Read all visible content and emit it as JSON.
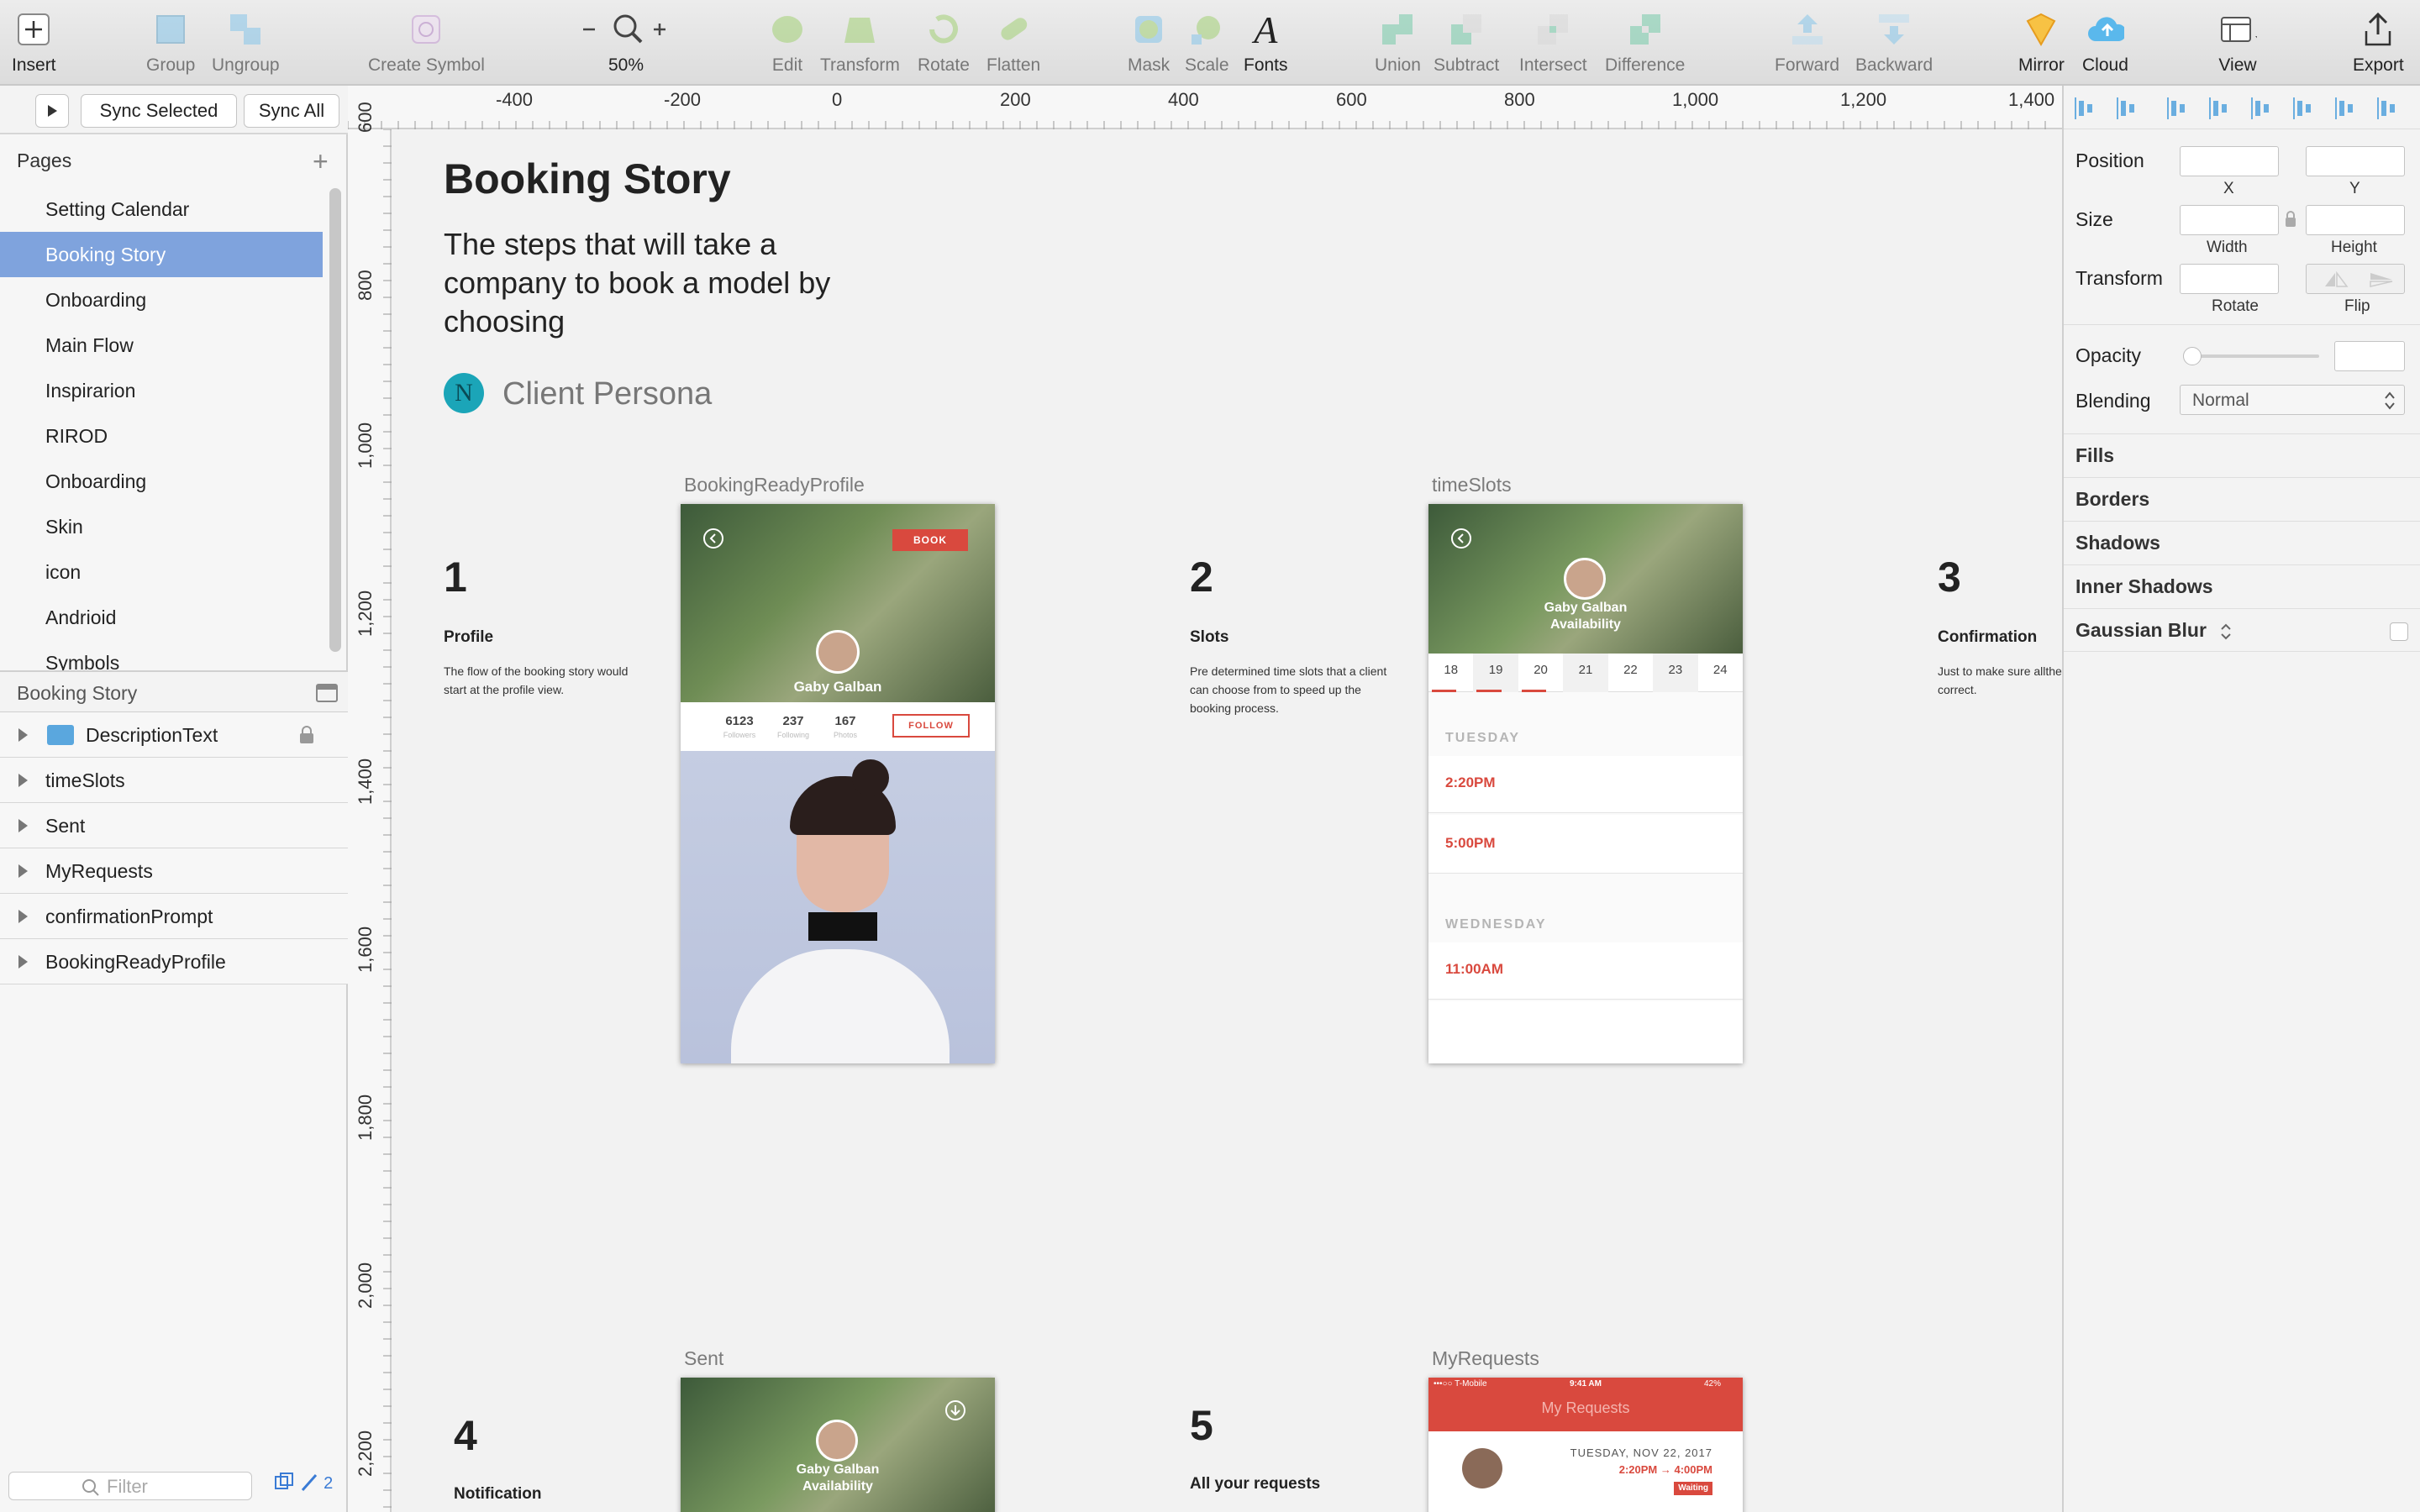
{
  "toolbar": {
    "insert": "Insert",
    "group": "Group",
    "ungroup": "Ungroup",
    "create_symbol": "Create Symbol",
    "zoom": "50%",
    "edit": "Edit",
    "transform": "Transform",
    "rotate": "Rotate",
    "flatten": "Flatten",
    "mask": "Mask",
    "scale": "Scale",
    "fonts": "Fonts",
    "union": "Union",
    "subtract": "Subtract",
    "intersect": "Intersect",
    "difference": "Difference",
    "forward": "Forward",
    "backward": "Backward",
    "mirror": "Mirror",
    "cloud": "Cloud",
    "view": "View",
    "export": "Export"
  },
  "sidebar": {
    "sync_selected": "Sync Selected",
    "sync_all": "Sync All",
    "pages_title": "Pages",
    "pages": [
      {
        "label": "Setting Calendar"
      },
      {
        "label": "Booking Story"
      },
      {
        "label": "Onboarding"
      },
      {
        "label": "Main Flow"
      },
      {
        "label": "Inspirarion"
      },
      {
        "label": "RIROD"
      },
      {
        "label": "Onboarding"
      },
      {
        "label": "Skin"
      },
      {
        "label": "icon"
      },
      {
        "label": "Andrioid"
      },
      {
        "label": "Symbols"
      }
    ],
    "selected_page": 1,
    "layers_title": "Booking Story",
    "layers": [
      {
        "label": "DescriptionText"
      },
      {
        "label": "timeSlots"
      },
      {
        "label": "Sent"
      },
      {
        "label": "MyRequests"
      },
      {
        "label": "confirmationPrompt"
      },
      {
        "label": "BookingReadyProfile"
      }
    ],
    "filter_placeholder": "Filter",
    "slice_count": "2"
  },
  "ruler": {
    "h": [
      "-400",
      "-200",
      "0",
      "200",
      "400",
      "600",
      "800",
      "1,000",
      "1,200",
      "1,400"
    ],
    "v": [
      "600",
      "800",
      "1,000",
      "1,200",
      "1,400",
      "1,600",
      "1,800",
      "2,000",
      "2,200"
    ]
  },
  "canvas": {
    "title": "Booking Story",
    "subtitle_lines": [
      "The steps that will take a",
      "company to book a model by",
      "choosing"
    ],
    "persona": "Client Persona",
    "persona_initial": "N",
    "steps": [
      {
        "num": "1",
        "title": "Profile",
        "desc_lines": [
          "The flow of the booking story would",
          "start at the profile view."
        ]
      },
      {
        "num": "2",
        "title": "Slots",
        "desc_lines": [
          "Pre determined time slots that a client",
          "can choose from to speed up the",
          "booking process."
        ]
      },
      {
        "num": "3",
        "title": "Confirmation",
        "desc_lines": [
          "Just to make sure allthe",
          "correct."
        ]
      },
      {
        "num": "4",
        "title": "Notification",
        "desc_lines": []
      },
      {
        "num": "5",
        "title": "All your requests",
        "desc_lines": []
      }
    ],
    "artboards": {
      "profile": {
        "label": "BookingReadyProfile",
        "book": "BOOK",
        "name": "Gaby Galban",
        "follow": "FOLLOW",
        "stats": [
          {
            "value": "6123",
            "label": "Followers"
          },
          {
            "value": "237",
            "label": "Following"
          },
          {
            "value": "167",
            "label": "Photos"
          }
        ]
      },
      "slots": {
        "label": "timeSlots",
        "name": "Gaby Galban",
        "sub": "Availability",
        "dates": [
          "18",
          "19",
          "20",
          "21",
          "22",
          "23",
          "24"
        ],
        "day1": "TUESDAY",
        "day1_times": [
          "2:20PM",
          "5:00PM"
        ],
        "day2": "WEDNESDAY",
        "day2_times": [
          "11:00AM"
        ]
      },
      "sent": {
        "label": "Sent",
        "name": "Gaby Galban",
        "sub": "Availability"
      },
      "requests": {
        "label": "MyRequests",
        "carrier": "•••○○ T-Mobile",
        "time": "9:41 AM",
        "battery": "42%",
        "title": "My Requests",
        "date": "TUESDAY, NOV 22, 2017",
        "slot": "2:20PM → 4:00PM",
        "status": "Waiting"
      }
    }
  },
  "inspector": {
    "position": "Position",
    "x": "X",
    "y": "Y",
    "size": "Size",
    "width": "Width",
    "height": "Height",
    "transform": "Transform",
    "rotate": "Rotate",
    "flip": "Flip",
    "opacity": "Opacity",
    "blending": "Blending",
    "blending_value": "Normal",
    "sections": [
      "Fills",
      "Borders",
      "Shadows",
      "Inner Shadows",
      "Gaussian Blur"
    ]
  },
  "colors": {
    "accent_red": "#d9493e",
    "selection_blue": "#7fa3dd",
    "persona_teal": "#1ba5b8"
  }
}
